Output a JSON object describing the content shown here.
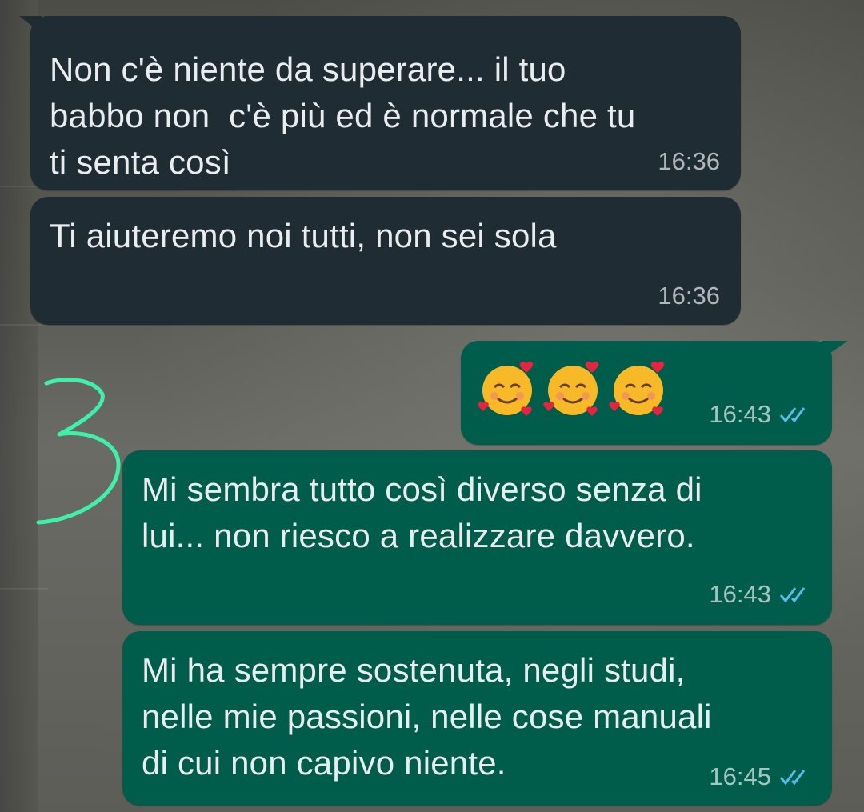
{
  "conversation": {
    "messages": [
      {
        "direction": "incoming",
        "text": "Non c'è niente da superare... il tuo\nbabbo non  c'è più ed è normale che tu\nti senta così",
        "time": "16:36"
      },
      {
        "direction": "incoming",
        "text": "Ti aiuteremo noi tutti, non sei sola",
        "time": "16:36"
      },
      {
        "direction": "outgoing",
        "text": "🥰🥰🥰",
        "time": "16:43",
        "status": "read"
      },
      {
        "direction": "outgoing",
        "text": "Mi sembra tutto così diverso senza di\nlui... non riesco a realizzare davvero.",
        "time": "16:43",
        "status": "read"
      },
      {
        "direction": "outgoing",
        "text": "Mi ha sempre sostenuta, negli studi,\nnelle mie passioni, nelle cose manuali\ndi cui non capivo niente.",
        "time": "16:45",
        "status": "read"
      }
    ]
  },
  "annotation": {
    "label": "3",
    "color": "#3ff0a8"
  },
  "colors": {
    "incoming_bubble": "#1f2c34",
    "outgoing_bubble": "#005c4b",
    "read_tick": "#53bdeb"
  },
  "icons": {
    "read_receipt": "double-check-icon",
    "emoji": "smiling-face-with-hearts"
  }
}
